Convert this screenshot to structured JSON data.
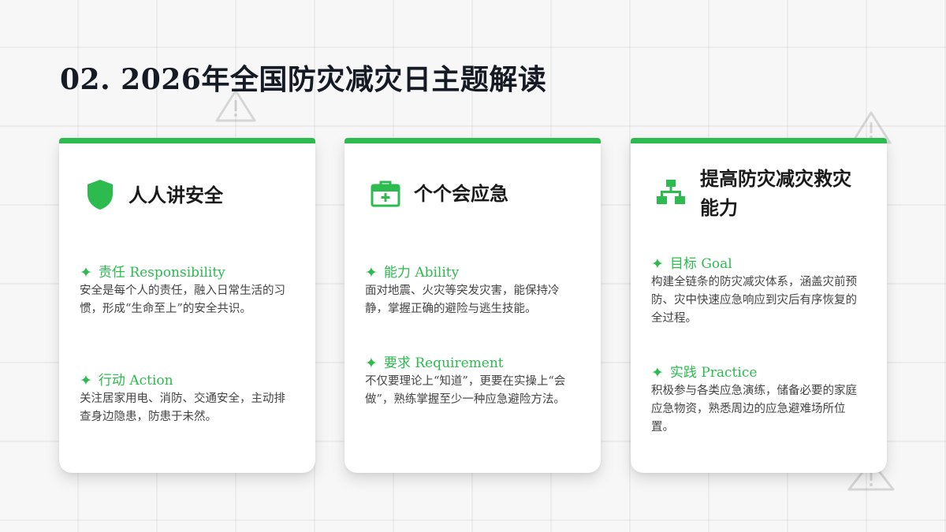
{
  "page": {
    "title": "02. 2026年全国防灾减灾日主题解读",
    "accent_color": "#2dbb4f"
  },
  "cards": [
    {
      "icon": "shield-icon",
      "title": "人人讲安全",
      "sections": [
        {
          "heading": "责任 Responsibility",
          "text": "安全是每个人的责任，融入日常生活的习惯，形成“生命至上”的安全共识。"
        },
        {
          "heading": "行动 Action",
          "text": "关注居家用电、消防、交通安全，主动排查身边隐患，防患于未然。"
        }
      ]
    },
    {
      "icon": "first-aid-kit-icon",
      "title": "个个会应急",
      "sections": [
        {
          "heading": "能力 Ability",
          "text": "面对地震、火灾等突发灾害，能保持冷静，掌握正确的避险与逃生技能。"
        },
        {
          "heading": "要求 Requirement",
          "text": "不仅要理论上“知道”，更要在实操上“会做”，熟练掌握至少一种应急避险方法。"
        }
      ]
    },
    {
      "icon": "hierarchy-icon",
      "title": "提高防灾减灾救灾能力",
      "sections": [
        {
          "heading": "目标 Goal",
          "text": "构建全链条的防灾减灾体系，涵盖灾前预防、灾中快速应急响应到灾后有序恢复的全过程。"
        },
        {
          "heading": "实践 Practice",
          "text": "积极参与各类应急演练，储备必要的家庭应急物资，熟悉周边的应急避难场所位置。"
        }
      ]
    }
  ]
}
